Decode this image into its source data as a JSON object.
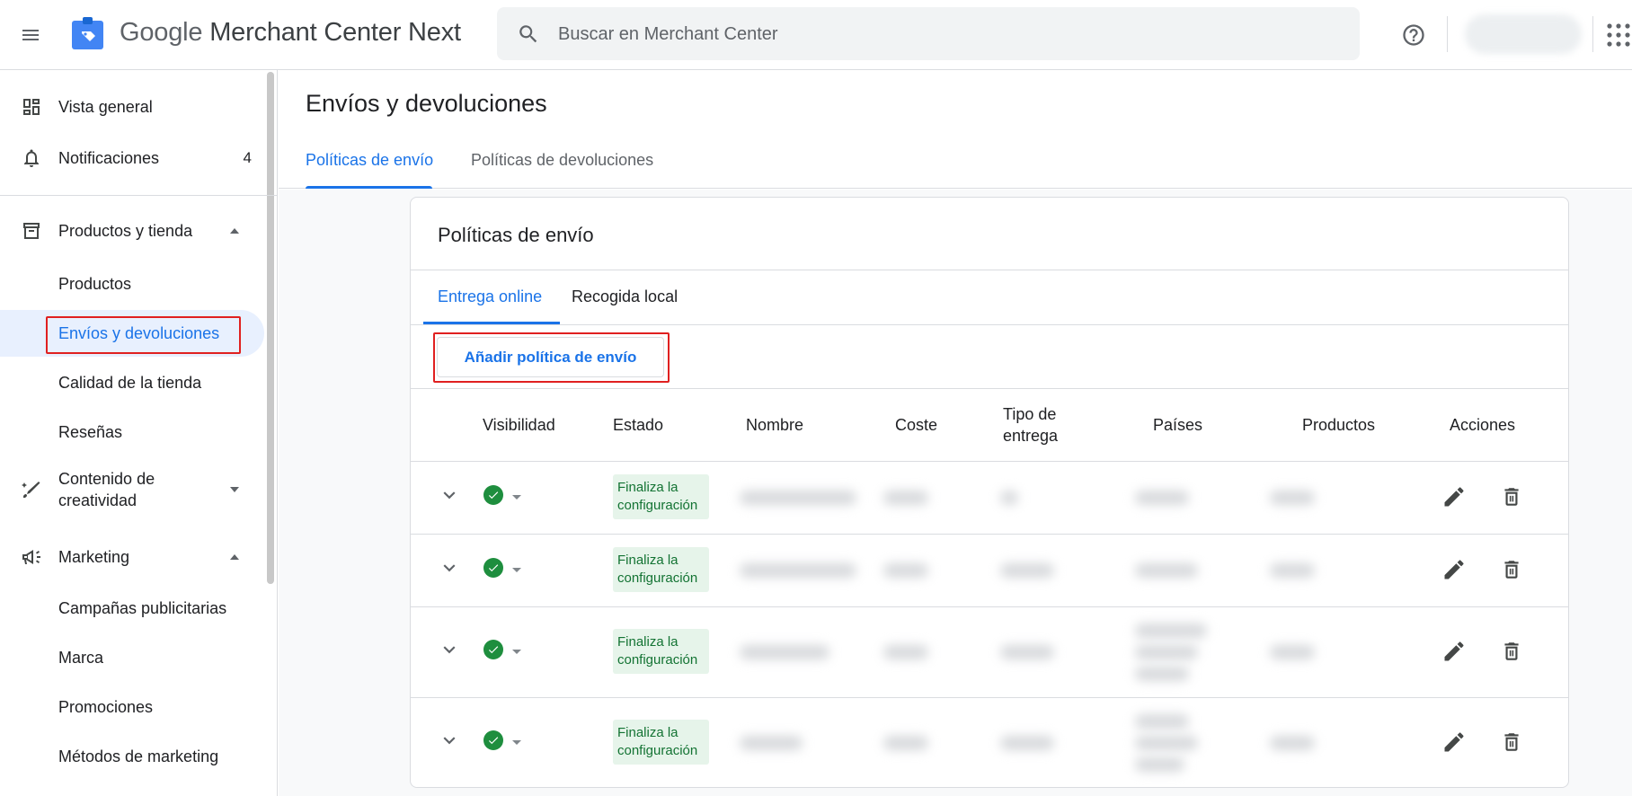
{
  "topbar": {
    "brand_google": "Google",
    "brand_product": "Merchant Center Next",
    "search_placeholder": "Buscar en Merchant Center"
  },
  "sidebar": {
    "items": [
      {
        "label": "Vista general",
        "icon": "dashboard-icon"
      },
      {
        "label": "Notificaciones",
        "icon": "bell-icon",
        "count": "4"
      },
      {
        "label": "Productos y tienda",
        "icon": "store-icon",
        "expanded": true
      },
      {
        "label": "Productos"
      },
      {
        "label": "Envíos y devoluciones",
        "active": true
      },
      {
        "label": "Calidad de la tienda"
      },
      {
        "label": "Reseñas"
      },
      {
        "label": "Contenido de creatividad",
        "icon": "creative-icon",
        "expanded": false
      },
      {
        "label": "Marketing",
        "icon": "megaphone-icon",
        "expanded": true
      },
      {
        "label": "Campañas publicitarias"
      },
      {
        "label": "Marca"
      },
      {
        "label": "Promociones"
      },
      {
        "label": "Métodos de marketing"
      }
    ]
  },
  "main": {
    "title": "Envíos y devoluciones",
    "tabs": [
      "Políticas de envío",
      "Políticas de devoluciones"
    ]
  },
  "card": {
    "title": "Políticas de envío",
    "tabs": [
      "Entrega online",
      "Recogida local"
    ],
    "add_button": "Añadir política de envío",
    "columns": [
      "Visibilidad",
      "Estado",
      "Nombre",
      "Coste",
      "Tipo de entrega",
      "Países",
      "Productos",
      "Acciones"
    ],
    "rows": [
      {
        "status": "Finaliza la configuración"
      },
      {
        "status": "Finaliza la configuración"
      },
      {
        "status": "Finaliza la configuración"
      },
      {
        "status": "Finaliza la configuración"
      }
    ]
  },
  "colors": {
    "accent": "#1a73e8",
    "status_bg": "#e6f4ea",
    "status_text": "#137333",
    "visible_green": "#1e8e3e",
    "highlight": "#e02020"
  }
}
